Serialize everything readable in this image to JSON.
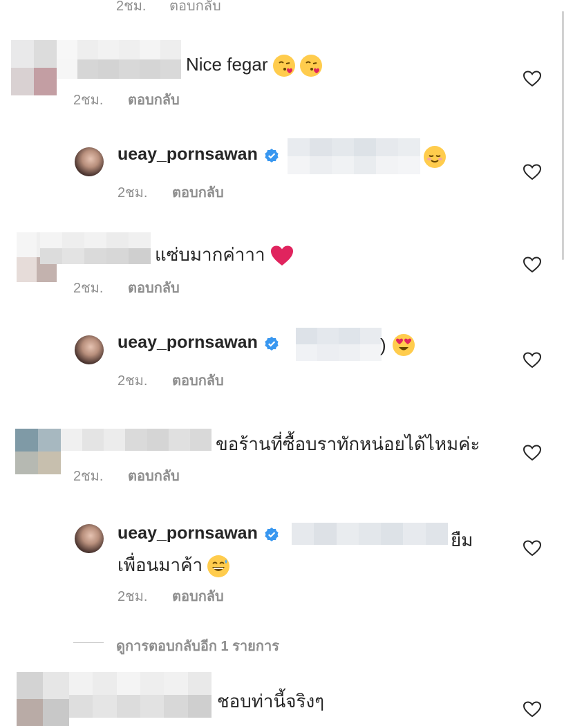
{
  "top_partial": {
    "time": "2ชม.",
    "reply": "ตอบกลับ"
  },
  "comments": [
    {
      "text": "Nice fegar",
      "time": "2ชม.",
      "reply": "ตอบกลับ",
      "emoji": [
        "kissing-heart-emoji",
        "kissing-heart-emoji"
      ]
    },
    {
      "text": "แซ่บมากค่าาา",
      "time": "2ชม.",
      "reply": "ตอบกลับ",
      "emoji": [
        "red-heart-emoji"
      ]
    },
    {
      "text": "ขอร้านที่ซื้อบราทักหน่อยได้ไหมค่ะ",
      "time": "2ชม.",
      "reply": "ตอบกลับ"
    },
    {
      "text": "ชอบท่านี้จริงๆ"
    }
  ],
  "replies": [
    {
      "username": "ueay_pornsawan",
      "time": "2ชม.",
      "reply": "ตอบกลับ",
      "emoji": [
        "smiling-emoji"
      ]
    },
    {
      "username": "ueay_pornsawan",
      "text_suffix": ")",
      "time": "2ชม.",
      "reply": "ตอบกลับ",
      "emoji": [
        "heart-eyes-emoji"
      ]
    },
    {
      "username": "ueay_pornsawan",
      "text_suffix": "ยืม",
      "line2": "เพื่อนมาค้า",
      "time": "2ชม.",
      "reply": "ตอบกลับ",
      "emoji": [
        "grinning-sweat-emoji"
      ]
    }
  ],
  "view_more_replies": "ดูการตอบกลับอีก 1 รายการ",
  "colors": {
    "text": "#262626",
    "muted": "#8e8e8e",
    "verified": "#3897f0",
    "emoji": "#ffcc4d",
    "heart_emoji": "#e0245e"
  }
}
